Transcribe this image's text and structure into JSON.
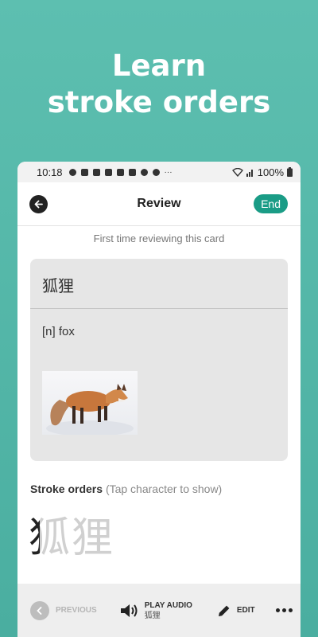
{
  "headline": {
    "line1": "Learn",
    "line2": "stroke orders"
  },
  "status_bar": {
    "time": "10:18",
    "battery": "100%"
  },
  "app_bar": {
    "title": "Review",
    "end_label": "End"
  },
  "review_note": "First time reviewing this card",
  "card": {
    "word": "狐狸",
    "meaning": "[n] fox"
  },
  "stroke_orders": {
    "label": "Stroke orders",
    "hint": "(Tap character to show)",
    "characters": [
      "狐",
      "狸"
    ]
  },
  "bottom_bar": {
    "previous_label": "PREVIOUS",
    "play_audio_label": "PLAY AUDIO",
    "play_audio_sub": "狐狸",
    "edit_label": "EDIT"
  },
  "colors": {
    "background": "#52b5a7",
    "accent": "#1a9c86"
  }
}
